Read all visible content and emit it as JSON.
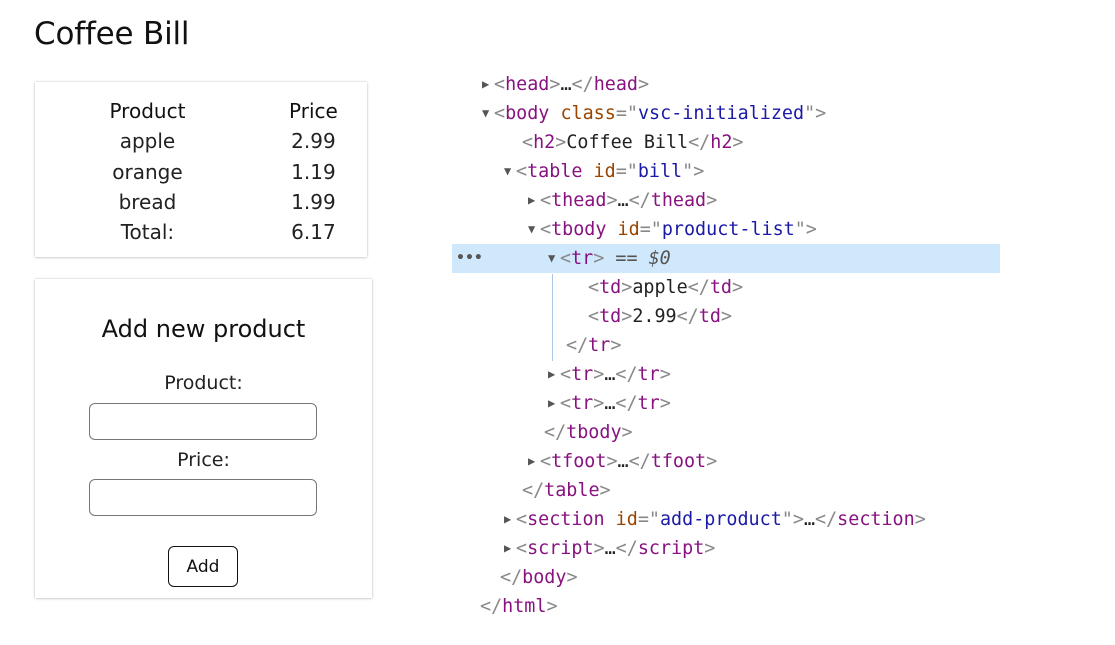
{
  "page": {
    "title": "Coffee Bill"
  },
  "bill": {
    "headers": {
      "product": "Product",
      "price": "Price"
    },
    "rows": [
      {
        "product": "apple",
        "price": "2.99"
      },
      {
        "product": "orange",
        "price": "1.19"
      },
      {
        "product": "bread",
        "price": "1.99"
      }
    ],
    "total": {
      "label": "Total:",
      "value": "6.17"
    }
  },
  "form": {
    "title": "Add new product",
    "product_label": "Product:",
    "product_value": "",
    "price_label": "Price:",
    "price_value": "",
    "add_label": "Add"
  },
  "devtools": {
    "more_glyph": "•••",
    "expanded_arrow": "▼",
    "collapsed_arrow": "▶",
    "eq_text": "== $0",
    "tags": {
      "head": "head",
      "body": "body",
      "h2": "h2",
      "table": "table",
      "thead": "thead",
      "tbody": "tbody",
      "tr": "tr",
      "td": "td",
      "tfoot": "tfoot",
      "section": "section",
      "script": "script",
      "html": "html"
    },
    "attrs": {
      "class": "class",
      "body_class": "vsc-initialized",
      "id": "id",
      "table_id": "bill",
      "tbody_id": "product-list",
      "section_id": "add-product"
    },
    "texts": {
      "h2": "Coffee Bill",
      "td1": "apple",
      "td2": "2.99"
    },
    "ellipsis": "…"
  },
  "colors": {
    "tag": "#881280",
    "attr_name": "#994500",
    "attr_value": "#1a1aa6",
    "selection": "#cfe8fc",
    "guide": "#a9c6e6"
  }
}
